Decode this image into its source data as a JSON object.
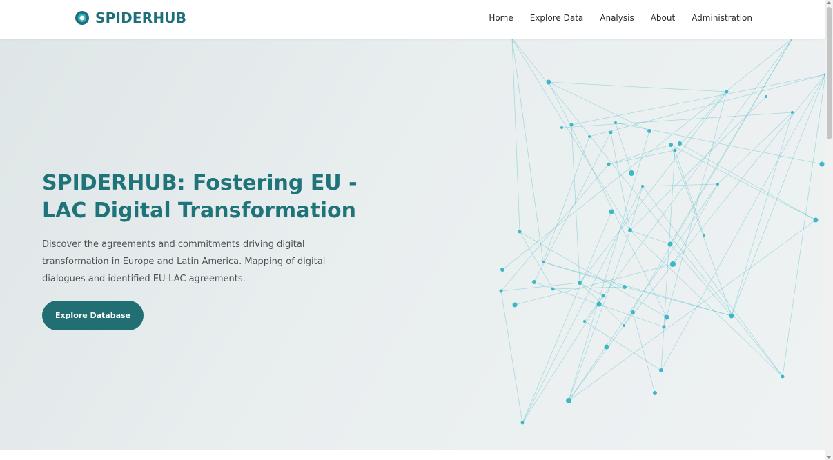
{
  "brand": {
    "name": "SPIDERHUB",
    "primary_color": "#1f6f7a",
    "button_color": "#216f73",
    "node_color": "#2bb3c0"
  },
  "nav": {
    "items": [
      {
        "label": "Home"
      },
      {
        "label": "Explore Data"
      },
      {
        "label": "Analysis"
      },
      {
        "label": "About"
      },
      {
        "label": "Administration"
      }
    ]
  },
  "hero": {
    "title": "SPIDERHUB: Fostering EU - LAC Digital Transformation",
    "description": "Discover the agreements and commitments driving digital transformation in Europe and Latin America. Mapping of digital dialogues and identified EU-LAC agreements.",
    "cta_label": "Explore Database"
  },
  "icons": {
    "logo": "ring-logo-icon",
    "scroll_up": "chevron-up-icon",
    "scroll_down": "chevron-down-icon"
  }
}
